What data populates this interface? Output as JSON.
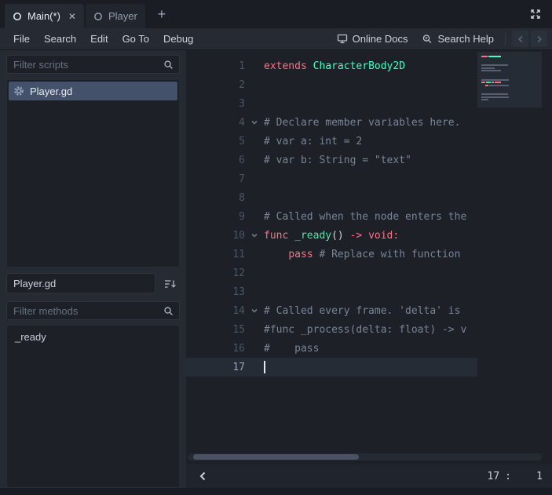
{
  "window": {
    "tabs": [
      {
        "label": "Main(*)",
        "active": true
      },
      {
        "label": "Player",
        "active": false
      }
    ],
    "close_glyph": "✕",
    "add_tab_glyph": "+"
  },
  "menu": {
    "items": [
      "File",
      "Search",
      "Edit",
      "Go To",
      "Debug"
    ],
    "online_docs": "Online Docs",
    "search_help": "Search Help"
  },
  "sidebar": {
    "filter_scripts_placeholder": "Filter scripts",
    "scripts": [
      {
        "name": "Player.gd",
        "selected": true
      }
    ],
    "path_value": "Player.gd",
    "filter_methods_placeholder": "Filter methods",
    "methods": [
      "_ready"
    ]
  },
  "editor": {
    "lines": [
      {
        "n": 1,
        "tokens": [
          {
            "t": "extends ",
            "c": "kw"
          },
          {
            "t": "CharacterBody2D",
            "c": "cls"
          }
        ]
      },
      {
        "n": 2,
        "tokens": []
      },
      {
        "n": 3,
        "tokens": []
      },
      {
        "n": 4,
        "fold": true,
        "tokens": [
          {
            "t": "# Declare member variables here.",
            "c": "cm"
          }
        ]
      },
      {
        "n": 5,
        "tokens": [
          {
            "t": "# var a: int = 2",
            "c": "cm"
          }
        ]
      },
      {
        "n": 6,
        "tokens": [
          {
            "t": "# var b: String = \"text\"",
            "c": "cm"
          }
        ]
      },
      {
        "n": 7,
        "tokens": []
      },
      {
        "n": 8,
        "tokens": []
      },
      {
        "n": 9,
        "tokens": [
          {
            "t": "# Called when the node enters the",
            "c": "cm"
          }
        ]
      },
      {
        "n": 10,
        "fold": true,
        "tokens": [
          {
            "t": "func ",
            "c": "kw"
          },
          {
            "t": "_ready",
            "c": "fn"
          },
          {
            "t": "() ",
            "c": "tx"
          },
          {
            "t": "-> void:",
            "c": "kw"
          }
        ]
      },
      {
        "n": 11,
        "tokens": [
          {
            "t": "    ",
            "c": "ws"
          },
          {
            "t": "pass",
            "c": "kw"
          },
          {
            "t": " # Replace with function",
            "c": "cm"
          }
        ]
      },
      {
        "n": 12,
        "tokens": []
      },
      {
        "n": 13,
        "tokens": []
      },
      {
        "n": 14,
        "fold": true,
        "tokens": [
          {
            "t": "# Called every frame. 'delta' is",
            "c": "cm"
          }
        ]
      },
      {
        "n": 15,
        "tokens": [
          {
            "t": "#func _process(delta: float) -> v",
            "c": "cm"
          }
        ]
      },
      {
        "n": 16,
        "tokens": [
          {
            "t": "#    pass",
            "c": "cm"
          }
        ]
      },
      {
        "n": 17,
        "current": true,
        "tokens": []
      }
    ],
    "status": {
      "line": "17",
      "sep": ":",
      "col": "1"
    }
  },
  "colors": {
    "keyword": "#ff7085",
    "type": "#42ffc2",
    "function": "#57e0a8",
    "comment": "#566070",
    "text": "#9aa2b0",
    "selection": "#44516b"
  },
  "icons": [
    "scene-circle-icon",
    "close-icon",
    "add-tab-icon",
    "expand-icon",
    "online-docs-icon",
    "search-help-icon",
    "nav-back-icon",
    "nav-forward-icon",
    "search-icon",
    "gear-icon",
    "sort-methods-icon",
    "fold-arrow-icon",
    "collapse-panel-icon"
  ]
}
